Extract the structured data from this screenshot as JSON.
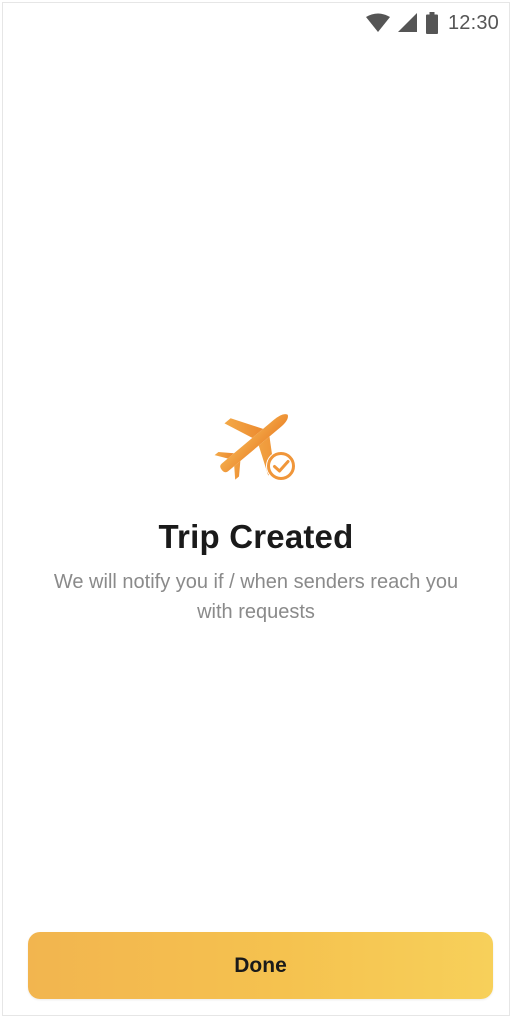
{
  "status_bar": {
    "time": "12:30",
    "icons": [
      "wifi-icon",
      "cellular-signal-icon",
      "battery-icon"
    ]
  },
  "hero": {
    "icon": "airplane-check-icon",
    "title": "Trip Created",
    "subtitle": "We will notify you if / when senders reach you with requests"
  },
  "footer": {
    "done_label": "Done"
  },
  "colors": {
    "accent_start": "#f2b54f",
    "accent_end": "#f7d05a",
    "plane_orange": "#f08f33",
    "text_primary": "#1a1a1a",
    "text_secondary": "#8a8a8a"
  }
}
